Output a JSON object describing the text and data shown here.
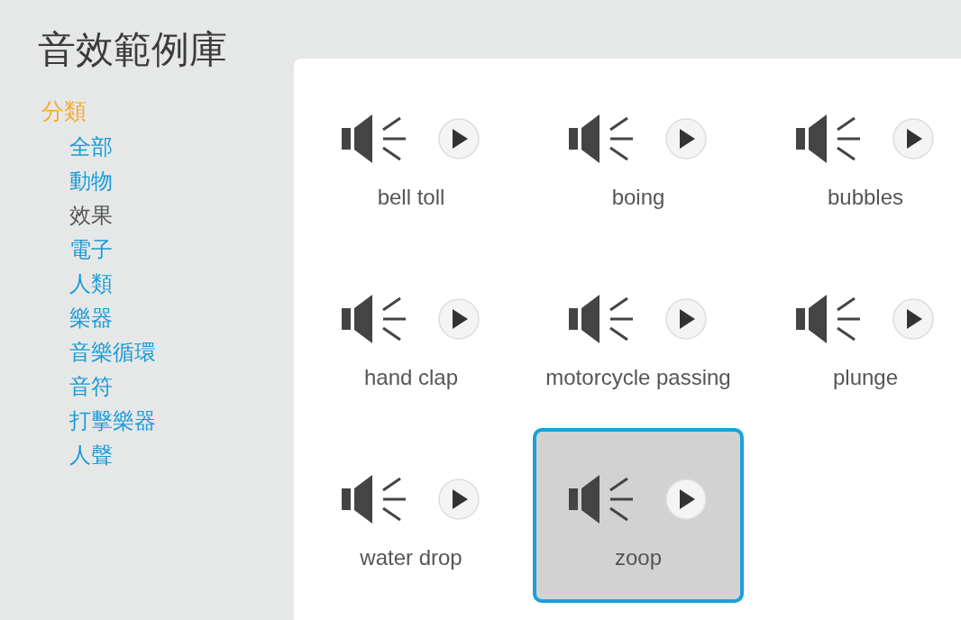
{
  "title": "音效範例庫",
  "sidebar": {
    "heading": "分類",
    "categories": [
      {
        "label": "全部",
        "selected": false
      },
      {
        "label": "動物",
        "selected": false
      },
      {
        "label": "效果",
        "selected": true
      },
      {
        "label": "電子",
        "selected": false
      },
      {
        "label": "人類",
        "selected": false
      },
      {
        "label": "樂器",
        "selected": false
      },
      {
        "label": "音樂循環",
        "selected": false
      },
      {
        "label": "音符",
        "selected": false
      },
      {
        "label": "打擊樂器",
        "selected": false
      },
      {
        "label": "人聲",
        "selected": false
      }
    ]
  },
  "sounds": [
    {
      "name": "bell toll",
      "selected": false
    },
    {
      "name": "boing",
      "selected": false
    },
    {
      "name": "bubbles",
      "selected": false
    },
    {
      "name": "hand clap",
      "selected": false
    },
    {
      "name": "motorcycle passing",
      "selected": false
    },
    {
      "name": "plunge",
      "selected": false
    },
    {
      "name": "water drop",
      "selected": false
    },
    {
      "name": "zoop",
      "selected": true
    }
  ]
}
